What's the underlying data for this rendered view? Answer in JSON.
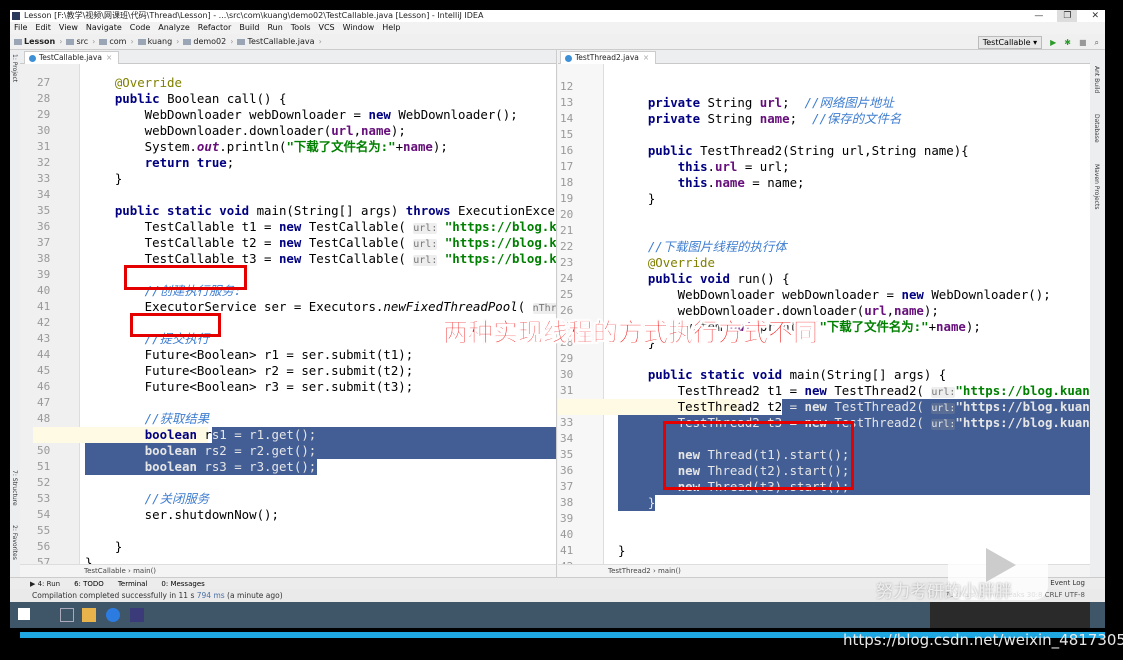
{
  "window": {
    "title": "Lesson [F:\\教学\\视频\\网课班\\代码\\Thread\\Lesson] - ...\\src\\com\\kuang\\demo02\\TestCallable.java [Lesson] - IntelliJ IDEA",
    "controls": [
      "—",
      "❐",
      "✕"
    ]
  },
  "menu": [
    "File",
    "Edit",
    "View",
    "Navigate",
    "Code",
    "Analyze",
    "Refactor",
    "Build",
    "Run",
    "Tools",
    "VCS",
    "Window",
    "Help"
  ],
  "breadcrumb": [
    "Lesson",
    "src",
    "com",
    "kuang",
    "demo02",
    "TestCallable.java"
  ],
  "run_config": "TestCallable ▾",
  "left_editor": {
    "tab": "TestCallable.java",
    "first_line": 27,
    "lines": [
      [
        [
          "a",
          "    @Override"
        ]
      ],
      [
        [
          "p",
          "    "
        ],
        [
          "k",
          "public"
        ],
        [
          "p",
          " Boolean call() {"
        ]
      ],
      [
        [
          "p",
          "        WebDownloader webDownloader = "
        ],
        [
          "k",
          "new"
        ],
        [
          "p",
          " WebDownloader();"
        ]
      ],
      [
        [
          "p",
          "        webDownloader.downloader("
        ],
        [
          "f",
          "url"
        ],
        [
          "p",
          ","
        ],
        [
          "f",
          "name"
        ],
        [
          "p",
          ");"
        ]
      ],
      [
        [
          "p",
          "        System."
        ],
        [
          "fi",
          "out"
        ],
        [
          "p",
          ".println("
        ],
        [
          "s",
          "\"下载了文件名为:\""
        ],
        [
          "p",
          "+"
        ],
        [
          "f",
          "name"
        ],
        [
          "p",
          ");"
        ]
      ],
      [
        [
          "p",
          "        "
        ],
        [
          "k",
          "return true"
        ],
        [
          "p",
          ";"
        ]
      ],
      [
        [
          "p",
          "    }"
        ]
      ],
      [],
      [
        [
          "p",
          "    "
        ],
        [
          "k",
          "public static void"
        ],
        [
          "p",
          " main(String[] args) "
        ],
        [
          "k",
          "throws"
        ],
        [
          "p",
          " ExecutionException"
        ]
      ],
      [
        [
          "p",
          "        TestCallable t1 = "
        ],
        [
          "k",
          "new"
        ],
        [
          "p",
          " TestCallable( "
        ],
        [
          "h",
          "url:"
        ],
        [
          "s",
          " \"https://blog.kuangstudy.com\""
        ]
      ],
      [
        [
          "p",
          "        TestCallable t2 = "
        ],
        [
          "k",
          "new"
        ],
        [
          "p",
          " TestCallable( "
        ],
        [
          "h",
          "url:"
        ],
        [
          "s",
          " \"https://blog.kuangstudy.com\""
        ]
      ],
      [
        [
          "p",
          "        TestCallable t3 = "
        ],
        [
          "k",
          "new"
        ],
        [
          "p",
          " TestCallable( "
        ],
        [
          "h",
          "url:"
        ],
        [
          "s",
          " \"https://blog.kuangstudy.com\""
        ]
      ],
      [],
      [
        [
          "c",
          "        //创建执行服务:"
        ]
      ],
      [
        [
          "p",
          "        ExecutorService ser = Executors."
        ],
        [
          "i",
          "newFixedThreadPool"
        ],
        [
          "p",
          "( "
        ],
        [
          "h",
          "nThreads:"
        ]
      ],
      [],
      [
        [
          "c",
          "        //提交执行"
        ]
      ],
      [
        [
          "p",
          "        Future<Boolean> r1 = ser.submit(t1);"
        ]
      ],
      [
        [
          "p",
          "        Future<Boolean> r2 = ser.submit(t2);"
        ]
      ],
      [
        [
          "p",
          "        Future<Boolean> r3 = ser.submit(t3);"
        ]
      ],
      [],
      [
        [
          "c",
          "        //获取结果"
        ]
      ],
      [
        [
          "p",
          "        "
        ],
        [
          "k",
          "boolean"
        ],
        [
          "p",
          " rs1 = r1.get();"
        ]
      ],
      [
        [
          "p",
          "        "
        ],
        [
          "k",
          "boolean"
        ],
        [
          "p",
          " rs2 = r2.get();"
        ]
      ],
      [
        [
          "p",
          "        "
        ],
        [
          "k",
          "boolean"
        ],
        [
          "p",
          " rs3 = r3.get();"
        ]
      ],
      [],
      [
        [
          "c",
          "        //关闭服务"
        ]
      ],
      [
        [
          "p",
          "        ser.shutdownNow();"
        ]
      ],
      [],
      [
        [
          "p",
          "    }"
        ]
      ],
      [
        [
          "p",
          "}"
        ]
      ]
    ],
    "crumbs": "TestCallable  ›  main()"
  },
  "right_editor": {
    "tab": "TestThread2.java",
    "first_line": 12,
    "lines": [
      [],
      [
        [
          "p",
          "    "
        ],
        [
          "k",
          "private"
        ],
        [
          "p",
          " String "
        ],
        [
          "f",
          "url"
        ],
        [
          "p",
          ";  "
        ],
        [
          "c",
          "//网络图片地址"
        ]
      ],
      [
        [
          "p",
          "    "
        ],
        [
          "k",
          "private"
        ],
        [
          "p",
          " String "
        ],
        [
          "f",
          "name"
        ],
        [
          "p",
          ";  "
        ],
        [
          "c",
          "//保存的文件名"
        ]
      ],
      [],
      [
        [
          "p",
          "    "
        ],
        [
          "k",
          "public"
        ],
        [
          "p",
          " TestThread2(String url,String name){"
        ]
      ],
      [
        [
          "p",
          "        "
        ],
        [
          "k",
          "this"
        ],
        [
          "p",
          "."
        ],
        [
          "f",
          "url"
        ],
        [
          "p",
          " = url;"
        ]
      ],
      [
        [
          "p",
          "        "
        ],
        [
          "k",
          "this"
        ],
        [
          "p",
          "."
        ],
        [
          "f",
          "name"
        ],
        [
          "p",
          " = name;"
        ]
      ],
      [
        [
          "p",
          "    }"
        ]
      ],
      [],
      [],
      [
        [
          "c",
          "    //下载图片线程的执行体"
        ]
      ],
      [
        [
          "a",
          "    @Override"
        ]
      ],
      [
        [
          "p",
          "    "
        ],
        [
          "k",
          "public void"
        ],
        [
          "p",
          " run() {"
        ]
      ],
      [
        [
          "p",
          "        WebDownloader webDownloader = "
        ],
        [
          "k",
          "new"
        ],
        [
          "p",
          " WebDownloader();"
        ]
      ],
      [
        [
          "p",
          "        webDownloader.downloader("
        ],
        [
          "f",
          "url"
        ],
        [
          "p",
          ","
        ],
        [
          "f",
          "name"
        ],
        [
          "p",
          ");"
        ]
      ],
      [
        [
          "p",
          "        System."
        ],
        [
          "fi",
          "out"
        ],
        [
          "p",
          ".println("
        ],
        [
          "s",
          "\"下载了文件名为:\""
        ],
        [
          "p",
          "+"
        ],
        [
          "f",
          "name"
        ],
        [
          "p",
          ");"
        ]
      ],
      [
        [
          "p",
          "    }"
        ]
      ],
      [],
      [
        [
          "p",
          "    "
        ],
        [
          "k",
          "public static void"
        ],
        [
          "p",
          " main(String[] args) {"
        ]
      ],
      [
        [
          "p",
          "        TestThread2 t1 = "
        ],
        [
          "k",
          "new"
        ],
        [
          "p",
          " TestThread2( "
        ],
        [
          "h",
          "url:"
        ],
        [
          "s",
          "\"https://blog.kuangstudy.com\""
        ]
      ],
      [
        [
          "p",
          "        TestThread2 t2 = "
        ],
        [
          "k",
          "new"
        ],
        [
          "p",
          " TestThread2( "
        ],
        [
          "h",
          "url:"
        ],
        [
          "s",
          "\"https://blog.kuangstudy.com\""
        ]
      ],
      [
        [
          "p",
          "        TestThread2 t3 = "
        ],
        [
          "k",
          "new"
        ],
        [
          "p",
          " TestThread2( "
        ],
        [
          "h",
          "url:"
        ],
        [
          "s",
          "\"https://blog.kuangstudy.com\""
        ]
      ],
      [],
      [
        [
          "p",
          "        "
        ],
        [
          "k",
          "new"
        ],
        [
          "p",
          " Thread(t1).start();"
        ]
      ],
      [
        [
          "p",
          "        "
        ],
        [
          "k",
          "new"
        ],
        [
          "p",
          " Thread(t2).start();"
        ]
      ],
      [
        [
          "p",
          "        "
        ],
        [
          "k",
          "new"
        ],
        [
          "p",
          " Thread(t3).start();"
        ]
      ],
      [
        [
          "p",
          "    }"
        ]
      ],
      [],
      [],
      [
        [
          "p",
          "}"
        ]
      ],
      []
    ],
    "crumbs": "TestThread2  ›  main()"
  },
  "left_side_tools": [
    "1: Project",
    "7: Structure",
    "2: Favorites"
  ],
  "right_side_tools": [
    "Ant Build",
    "Database",
    "Maven Projects"
  ],
  "tool_windows": [
    "▶ 4: Run",
    "6: TODO",
    "Terminal",
    "0: Messages"
  ],
  "event_log": "Event Log",
  "status": {
    "text": "Compilation completed successfully in 11 s ",
    "ms": "794 ms",
    "tail": " (a minute ago)",
    "right": "78 chars, 2 line breaks   30:8   CRLF   UTF-8"
  },
  "overlay_caption": "两种实现线程的方式执行方式不同",
  "watermark_url": "https://blog.csdn.net/weixin_48173054",
  "video_watermark": "努力考研的小胖胖",
  "colors": {
    "selection": "#214283",
    "keyword": "#000080",
    "string": "#008000",
    "comment": "#3e7dd0",
    "annotation_box": "#e50000",
    "progress": "#1fa7e1"
  }
}
